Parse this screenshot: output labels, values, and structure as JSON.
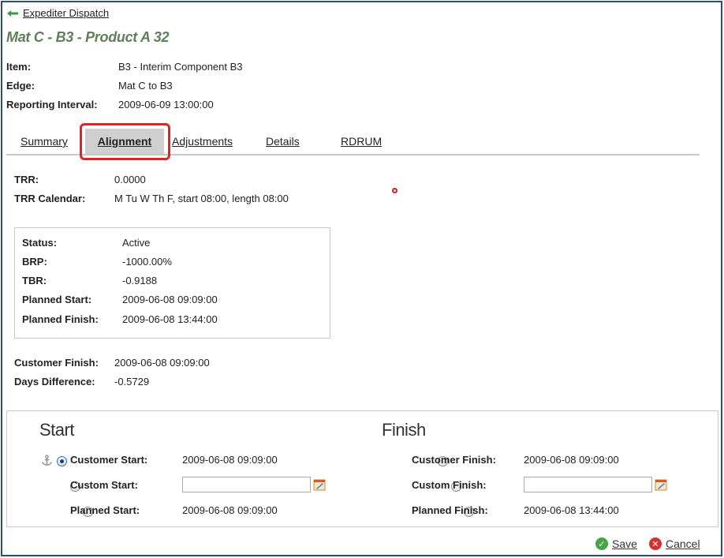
{
  "nav": {
    "back_label": "Expediter Dispatch"
  },
  "page_title": "Mat C - B3 - Product A 32",
  "info": [
    {
      "label": "Item:",
      "value": "B3 - Interim Component B3"
    },
    {
      "label": "Edge:",
      "value": "Mat C to B3"
    },
    {
      "label": "Reporting Interval:",
      "value": "2009-06-09 13:00:00"
    }
  ],
  "tabs": [
    {
      "label": "Summary"
    },
    {
      "label": "Alignment",
      "active": true
    },
    {
      "label": "Adjustments"
    },
    {
      "label": "Details"
    },
    {
      "label": "RDRUM"
    }
  ],
  "trr": [
    {
      "label": "TRR:",
      "value": "0.0000"
    },
    {
      "label": "TRR Calendar:",
      "value": "M Tu W Th F, start 08:00, length 08:00"
    }
  ],
  "status_box": [
    {
      "label": "Status:",
      "value": "Active"
    },
    {
      "label": "BRP:",
      "value": "-1000.00%"
    },
    {
      "label": "TBR:",
      "value": "-0.9188"
    },
    {
      "label": "Planned Start:",
      "value": "2009-06-08 09:09:00"
    },
    {
      "label": "Planned Finish:",
      "value": "2009-06-08 13:44:00"
    }
  ],
  "customer": [
    {
      "label": "Customer Finish:",
      "value": "2009-06-08 09:09:00"
    },
    {
      "label": "Days Difference:",
      "value": "-0.5729"
    }
  ],
  "alignment": {
    "start": {
      "heading": "Start",
      "options": [
        {
          "label": "Customer Start:",
          "value": "2009-06-08 09:09:00",
          "checked": true
        },
        {
          "label": "Custom Start:",
          "input_value": ""
        },
        {
          "label": "Planned Start:",
          "value": "2009-06-08 09:09:00"
        }
      ]
    },
    "finish": {
      "heading": "Finish",
      "options": [
        {
          "label": "Customer Finish:",
          "value": "2009-06-08 09:09:00",
          "checked": false
        },
        {
          "label": "Custom Finish:",
          "input_value": ""
        },
        {
          "label": "Planned Finish:",
          "value": "2009-06-08 13:44:00"
        }
      ]
    }
  },
  "footer": {
    "save_label": "Save",
    "cancel_label": "Cancel"
  },
  "colors": {
    "title": "#5f7f5a",
    "frame": "#2e4d73",
    "highlight": "#e32222",
    "active_tab": "#cfcfcf"
  },
  "icons": [
    "back-arrow-icon",
    "anchor-icon",
    "calendar-icon",
    "save-check-icon",
    "cancel-x-icon"
  ]
}
